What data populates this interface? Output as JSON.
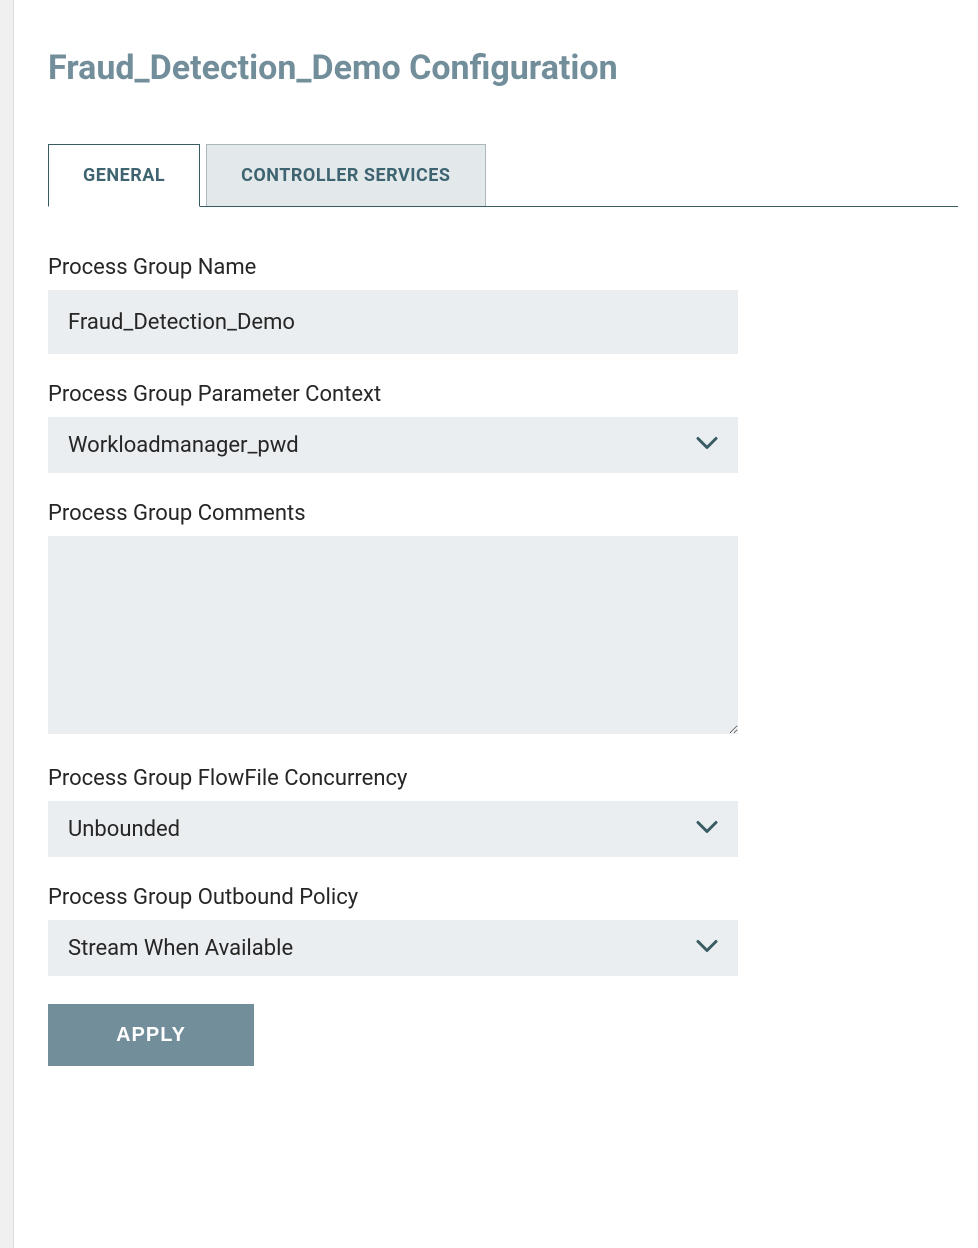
{
  "header": {
    "title": "Fraud_Detection_Demo Configuration"
  },
  "tabs": {
    "general": "GENERAL",
    "controller_services": "CONTROLLER SERVICES"
  },
  "form": {
    "process_group_name": {
      "label": "Process Group Name",
      "value": "Fraud_Detection_Demo"
    },
    "parameter_context": {
      "label": "Process Group Parameter Context",
      "value": "Workloadmanager_pwd"
    },
    "comments": {
      "label": "Process Group Comments",
      "value": ""
    },
    "flowfile_concurrency": {
      "label": "Process Group FlowFile Concurrency",
      "value": "Unbounded"
    },
    "outbound_policy": {
      "label": "Process Group Outbound Policy",
      "value": "Stream When Available"
    }
  },
  "buttons": {
    "apply": "APPLY"
  }
}
